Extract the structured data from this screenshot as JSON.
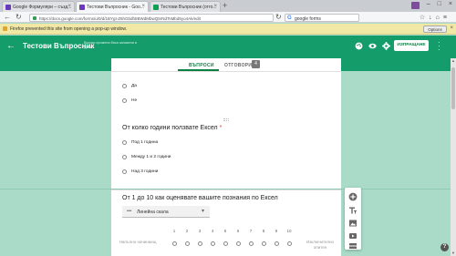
{
  "browser": {
    "tabs": [
      {
        "title": "Google Формуляри – създ...",
        "favicon_color": "#673ab7"
      },
      {
        "title": "Тестови Въпросник - Goo...",
        "favicon_color": "#673ab7"
      },
      {
        "title": "Тестови Въпросник (отго...",
        "favicon_color": "#0f9d58"
      }
    ],
    "new_tab_label": "+",
    "url": "https://docs.google.com/forms/u/0/d/1BYgI-Z6hGbdhtIBWdMbwQ5rNdTsMbd5yo4Ak/edit",
    "search_text": "google forms",
    "notification": {
      "message": "Firefox prevented this site from opening a pop-up window.",
      "options_label": "Options",
      "close_label": "×"
    }
  },
  "forms": {
    "title": "Тестови Въпросник",
    "saved_note": "Всички промени бяха запазени в Диск",
    "send_label": "ИЗПРАЩАНЕ",
    "tabs": {
      "questions": "ВЪПРОСИ",
      "answers": "ОТГОВОРИ",
      "answers_count": "4"
    }
  },
  "question1": {
    "options": [
      "Да",
      "Не"
    ]
  },
  "question2": {
    "title": "От колко години ползвате Ексел",
    "required_mark": "*",
    "options": [
      "Под 1 година",
      "Между 1 и 2 години",
      "Над 3 години"
    ]
  },
  "question3": {
    "title": "От 1 до 10 как оценявате вашите познания по Ексел",
    "type_label": "Линейна скала",
    "scale": [
      "1",
      "2",
      "3",
      "4",
      "5",
      "6",
      "7",
      "8",
      "9",
      "10"
    ],
    "left_label": "Напълно начинаещ",
    "right_label": "Изключително опитен"
  },
  "colors": {
    "header": "#149d6b",
    "background": "#a9dbc8",
    "accent": "#0b8043"
  }
}
